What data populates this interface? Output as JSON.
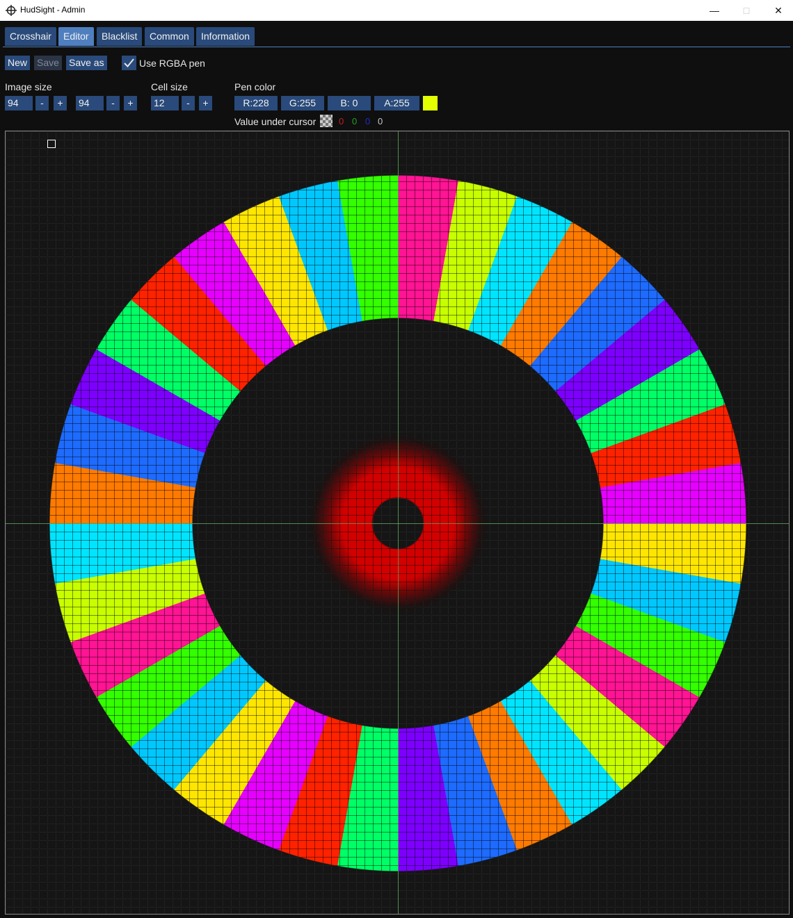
{
  "window": {
    "title": "HudSight - Admin"
  },
  "tabs": [
    {
      "label": "Crosshair"
    },
    {
      "label": "Editor",
      "active": true
    },
    {
      "label": "Blacklist"
    },
    {
      "label": "Common"
    },
    {
      "label": "Information"
    }
  ],
  "toolbar": {
    "new_label": "New",
    "save_label": "Save",
    "save_as_label": "Save as",
    "use_rgba_label": "Use RGBA pen",
    "use_rgba_checked": true
  },
  "image_size": {
    "label": "Image size",
    "width": "94",
    "height": "94",
    "minus": "-",
    "plus": "+"
  },
  "cell_size": {
    "label": "Cell size",
    "value": "12",
    "minus": "-",
    "plus": "+"
  },
  "pen_color": {
    "label": "Pen color",
    "r": "R:228",
    "g": "G:255",
    "b": "B:  0",
    "a": "A:255",
    "swatch": "#e4ff00"
  },
  "value_under_cursor": {
    "label": "Value under cursor",
    "r": "0",
    "g": "0",
    "b": "0",
    "a": "0"
  },
  "colors": {
    "accent": "#4f7fbf",
    "button": "#294a7a",
    "background": "#0f0f0f"
  }
}
